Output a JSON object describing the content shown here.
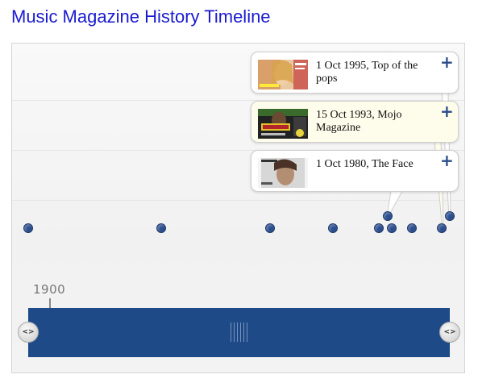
{
  "page": {
    "title": "Music Magazine History Timeline"
  },
  "timeline": {
    "events": [
      {
        "caption": "1 Oct 1995, Top of the pops",
        "highlighted": false
      },
      {
        "caption": "15 Oct 1993, Mojo Magazine",
        "highlighted": true
      },
      {
        "caption": "1 Oct 1980, The Face",
        "highlighted": false
      }
    ],
    "expand_icon": "plus-icon",
    "scale_label": "1900",
    "handle_icon": "left-right-arrows-icon",
    "colors": {
      "title": "#1a1ad0",
      "point": "#2d4f8e",
      "band": "#1f4a88",
      "highlight_card": "#fefcea"
    }
  }
}
